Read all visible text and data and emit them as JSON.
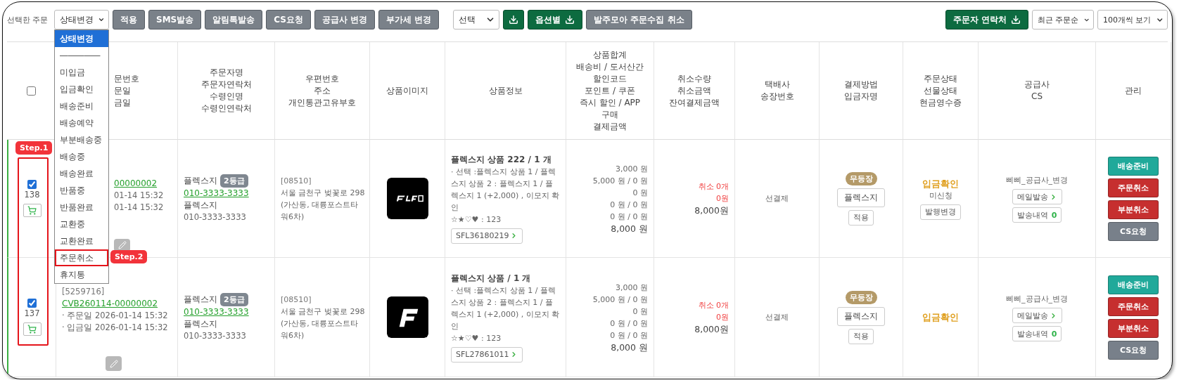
{
  "toolbar": {
    "label": "선택한 주문",
    "status_select": "상태변경",
    "action_buttons": [
      "적용",
      "SMS발송",
      "알림톡발송",
      "CS요청",
      "공급사 변경",
      "부가세 변경"
    ],
    "export_select": "선택",
    "option_button": "옵션별",
    "cancel_collect_button": "발주모아 주문수집 취소",
    "contact_button": "주문자 연락처",
    "sort_select": "최근 주문순",
    "page_size_select": "100개씩 보기"
  },
  "status_dropdown": {
    "items": [
      {
        "label": "상태변경",
        "selected": true,
        "marked": false
      },
      {
        "label": "―――――",
        "selected": false,
        "marked": false
      },
      {
        "label": "미입금",
        "selected": false,
        "marked": false
      },
      {
        "label": "입금확인",
        "selected": false,
        "marked": false
      },
      {
        "label": "배송준비",
        "selected": false,
        "marked": false
      },
      {
        "label": "배송예약",
        "selected": false,
        "marked": false
      },
      {
        "label": "부분배송중",
        "selected": false,
        "marked": false
      },
      {
        "label": "배송중",
        "selected": false,
        "marked": false
      },
      {
        "label": "배송완료",
        "selected": false,
        "marked": false
      },
      {
        "label": "반품중",
        "selected": false,
        "marked": false
      },
      {
        "label": "반품완료",
        "selected": false,
        "marked": false
      },
      {
        "label": "교환중",
        "selected": false,
        "marked": false
      },
      {
        "label": "교환완료",
        "selected": false,
        "marked": false
      },
      {
        "label": "주문취소",
        "selected": false,
        "marked": true
      },
      {
        "label": "휴지통",
        "selected": false,
        "marked": false
      }
    ]
  },
  "annotations": [
    {
      "label": "Step.1"
    },
    {
      "label": "Step.2"
    }
  ],
  "table": {
    "header_checkbox": {
      "checked": false
    },
    "columns": [
      [
        "문번호",
        "문일",
        "금일"
      ],
      [
        "주문자명",
        "주문자연락처",
        "수령인명",
        "수령인연락처"
      ],
      [
        "우편번호",
        "주소",
        "개인통관고유부호"
      ],
      [
        "상품이미지"
      ],
      [
        "상품정보"
      ],
      [
        "상품합계",
        "배송비 / 도서산간",
        "할인코드",
        "포인트 / 쿠폰",
        "즉시 할인 / APP",
        "구매",
        "결제금액"
      ],
      [
        "취소수량",
        "취소금액",
        "잔여결제금액"
      ],
      [
        "택배사",
        "송장번호"
      ],
      [
        "결제방법",
        "입금자명"
      ],
      [
        "주문상태",
        "선물상태",
        "현금영수증"
      ],
      [
        "공급사",
        "CS"
      ],
      [
        "관리"
      ]
    ],
    "rows": [
      {
        "checked": true,
        "number": "138",
        "order_code": "00000002",
        "dates": [
          "01-14 15:32",
          "01-14 15:32"
        ],
        "buyer": {
          "name": "플렉스지",
          "grade": "2등급",
          "phone": "010-3333-3333",
          "receiver": "플렉스지",
          "receiver_phone": "010-3333-3333"
        },
        "zip": "[08510]",
        "address": "서울 금천구 벚꽃로 298",
        "address_detail": "(가산동, 대륭포스트타워6차)",
        "image": {
          "kind": "picture"
        },
        "product": {
          "title": "플렉스지 상품 222 / 1 개",
          "options": "· 선택 :플렉스지 상품 1 / 플렉스지 상품 2 : 플렉스지 1 / 플렉스지 1 (+2,000) , 이모지 확인",
          "emoji": "☆★♡♥ : 123",
          "code": "SFL36180219"
        },
        "amounts": [
          "3,000 원",
          "5,000 원 / 0 원",
          "0 원",
          "0 원 / 0 원",
          "0 원 / 0 원"
        ],
        "total": "8,000 원",
        "cancel": {
          "qty": "취소 0개",
          "amount": "0원",
          "remaining": "8,000원"
        },
        "courier": "선결제",
        "payment": {
          "grade": "무등장",
          "payer": "플렉스지",
          "apply": "적용"
        },
        "status": {
          "order": "입금확인",
          "gift": "미신청",
          "receipt": "발행변경"
        },
        "supplier": {
          "name": "삐삐_공급사_변경",
          "mail": "메일발송",
          "history": "발송내역",
          "history_count": "0"
        },
        "actions": [
          {
            "label": "배송준비",
            "color": "#20a99a"
          },
          {
            "label": "주문취소",
            "color": "#c62f2f"
          },
          {
            "label": "부분취소",
            "color": "#c62f2f"
          },
          {
            "label": "CS요청",
            "color": "#78808a"
          }
        ]
      },
      {
        "checked": true,
        "number": "137",
        "order_id": "[5259716]",
        "order_code": "CVB260114-00000002",
        "dates": [
          "· 주문일 2026-01-14 15:32",
          "· 입금일 2026-01-14 15:32"
        ],
        "buyer": {
          "name": "플렉스지",
          "grade": "2등급",
          "phone": "010-3333-3333",
          "receiver": "플렉스지",
          "receiver_phone": "010-3333-3333"
        },
        "zip": "[08510]",
        "address": "서울 금천구 벚꽃로 298",
        "address_detail": "(가산동, 대륭포스트타워6차)",
        "image": {
          "kind": "picture"
        },
        "product": {
          "title": "플렉스지 상품 / 1 개",
          "options": "· 선택 :플렉스지 상품 1 / 플렉스지 상품 2 : 플렉스지 1 / 플렉스지 1 (+2,000) , 이모지 확인",
          "emoji": "☆★♡♥ : 123",
          "code": "SFL27861011"
        },
        "amounts": [
          "3,000 원",
          "5,000 원 / 0 원",
          "0 원",
          "0 원 / 0 원",
          "0 원 / 0 원"
        ],
        "total": "8,000 원",
        "cancel": {
          "qty": "취소 0개",
          "amount": "0원",
          "remaining": "8,000원"
        },
        "courier": "선결제",
        "payment": {
          "grade": "무등장",
          "payer": "플렉스지",
          "apply": "적용"
        },
        "status": {
          "order": "입금확인"
        },
        "supplier": {
          "name": "삐삐_공급사_변경",
          "mail": "메일발송",
          "history": "발송내역",
          "history_count": "0"
        },
        "actions": [
          {
            "label": "배송준비",
            "color": "#20a99a"
          },
          {
            "label": "주문취소",
            "color": "#c62f2f"
          },
          {
            "label": "부분취소",
            "color": "#c62f2f"
          },
          {
            "label": "CS요청",
            "color": "#78808a"
          }
        ]
      }
    ]
  }
}
